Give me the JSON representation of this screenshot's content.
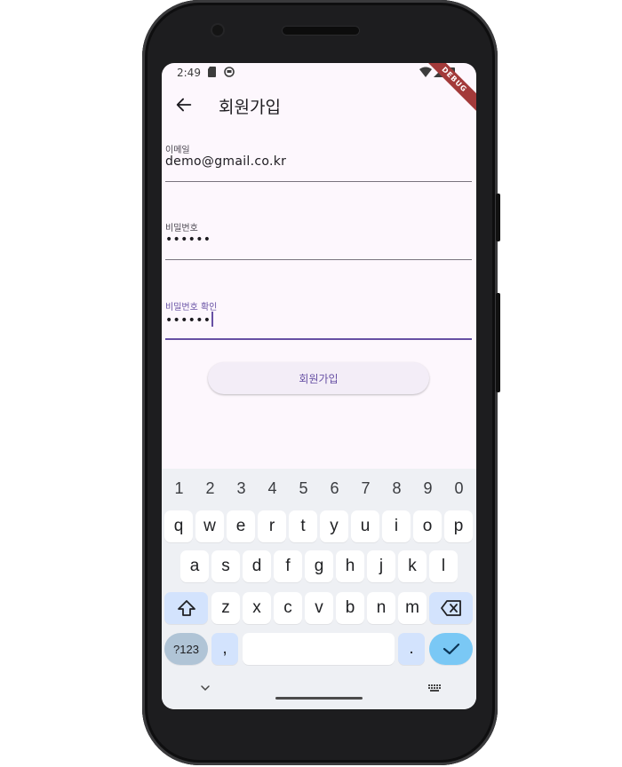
{
  "status": {
    "time": "2:49"
  },
  "debug_banner": "DEBUG",
  "appbar": {
    "title": "회원가입",
    "back_icon": "arrow-left-icon"
  },
  "form": {
    "email": {
      "label": "이메일",
      "value": "demo@gmail.co.kr"
    },
    "password": {
      "label": "비밀번호",
      "value": "••••••"
    },
    "password_confirm": {
      "label": "비밀번호 확인",
      "value": "••••••"
    }
  },
  "signup_button": "회원가입",
  "keyboard": {
    "numbers": [
      "1",
      "2",
      "3",
      "4",
      "5",
      "6",
      "7",
      "8",
      "9",
      "0"
    ],
    "row1": [
      "q",
      "w",
      "e",
      "r",
      "t",
      "y",
      "u",
      "i",
      "o",
      "p"
    ],
    "row2": [
      "a",
      "s",
      "d",
      "f",
      "g",
      "h",
      "j",
      "k",
      "l"
    ],
    "row3": [
      "z",
      "x",
      "c",
      "v",
      "b",
      "n",
      "m"
    ],
    "symbols_key": "?123",
    "comma": ",",
    "period": "."
  },
  "colors": {
    "accent": "#6750a4",
    "surface": "#fdf7fd",
    "keyboard_bg": "#eef0f4",
    "enter_key": "#7ac8f5"
  }
}
